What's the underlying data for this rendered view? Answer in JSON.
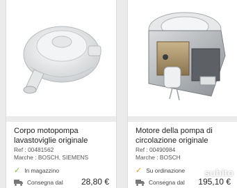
{
  "products": [
    {
      "title": "Corpo motopompa lavastoviglie originale",
      "ref_label": "Ref : ",
      "ref_value": "00481562",
      "brand_label": "Marche : ",
      "brand_value": "BOSCH, SIEMENS",
      "stock_status": "In magazzino",
      "stock_color": "#8bb63a",
      "delivery_label": "Consegna dal",
      "price": "28,80 €"
    },
    {
      "title": "Motore della pompa di circolazione originale",
      "ref_label": "Ref : ",
      "ref_value": "00490984",
      "brand_label": "Marche : ",
      "brand_value": "BOSCH",
      "stock_status": "Su ordinazione",
      "stock_color": "#e39a1b",
      "delivery_label": "Consegna dal",
      "price": "195,10 €"
    }
  ],
  "watermark": "subito"
}
